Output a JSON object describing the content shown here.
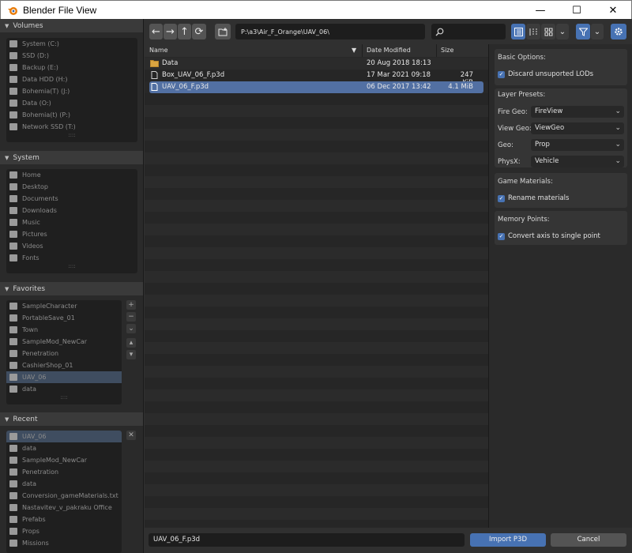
{
  "window": {
    "title": "Blender File View",
    "minimize": "—",
    "maximize": "☐",
    "close": "✕"
  },
  "sidebar": {
    "volumes": {
      "header": "Volumes",
      "items": [
        "System (C:)",
        "SSD (D:)",
        "Backup (E:)",
        "Data HDD (H:)",
        "Bohemia(T) (J:)",
        "Data (O:)",
        "Bohemia(t) (P:)",
        "Network SSD (T:)"
      ]
    },
    "system": {
      "header": "System",
      "items": [
        "Home",
        "Desktop",
        "Documents",
        "Downloads",
        "Music",
        "Pictures",
        "Videos",
        "Fonts"
      ]
    },
    "favorites": {
      "header": "Favorites",
      "items": [
        "SampleCharacter",
        "PortableSave_01",
        "Town",
        "SampleMod_NewCar",
        "Penetration",
        "CashierShop_01",
        "UAV_06",
        "data"
      ],
      "active_index": 6
    },
    "recent": {
      "header": "Recent",
      "items": [
        "UAV_06",
        "data",
        "SampleMod_NewCar",
        "Penetration",
        "data",
        "Conversion_gameMaterials.txt",
        "Nastavitev_v_pakraku Office",
        "Prefabs",
        "Props",
        "Missions"
      ],
      "active_index": 0
    }
  },
  "toolbar": {
    "back": "←",
    "forward": "→",
    "parent": "↑",
    "refresh": "⟳",
    "path": "P:\\a3\\Air_F_Orange\\UAV_06\\",
    "search_placeholder": ""
  },
  "filelist": {
    "columns": {
      "name": "Name",
      "date": "Date Modified",
      "size": "Size"
    },
    "rows": [
      {
        "name": "Data",
        "date": "20 Aug 2018 18:13",
        "size": "",
        "type": "folder",
        "selected": false
      },
      {
        "name": "Box_UAV_06_F.p3d",
        "date": "17 Mar 2021 09:18",
        "size": "247 KiB",
        "type": "file",
        "selected": false
      },
      {
        "name": "UAV_06_F.p3d",
        "date": "06 Dec 2017 13:42",
        "size": "4.1 MiB",
        "type": "file",
        "selected": true
      }
    ]
  },
  "props": {
    "basic_title": "Basic Options:",
    "discard_lods": "Discard unsuported LODs",
    "layer_title": "Layer Presets:",
    "fire_geo_label": "Fire Geo:",
    "fire_geo_value": "FireView",
    "view_geo_label": "View Geo:",
    "view_geo_value": "ViewGeo",
    "geo_label": "Geo:",
    "geo_value": "Prop",
    "physx_label": "PhysX:",
    "physx_value": "Vehicle",
    "game_mat_title": "Game Materials:",
    "rename_materials": "Rename materials",
    "memory_title": "Memory Points:",
    "convert_axis": "Convert axis to single point"
  },
  "bottom": {
    "filename": "UAV_06_F.p3d",
    "import_label": "Import P3D",
    "cancel_label": "Cancel"
  },
  "colors": {
    "accent": "#4772b3",
    "selection": "#5270a3",
    "background": "#303030"
  }
}
